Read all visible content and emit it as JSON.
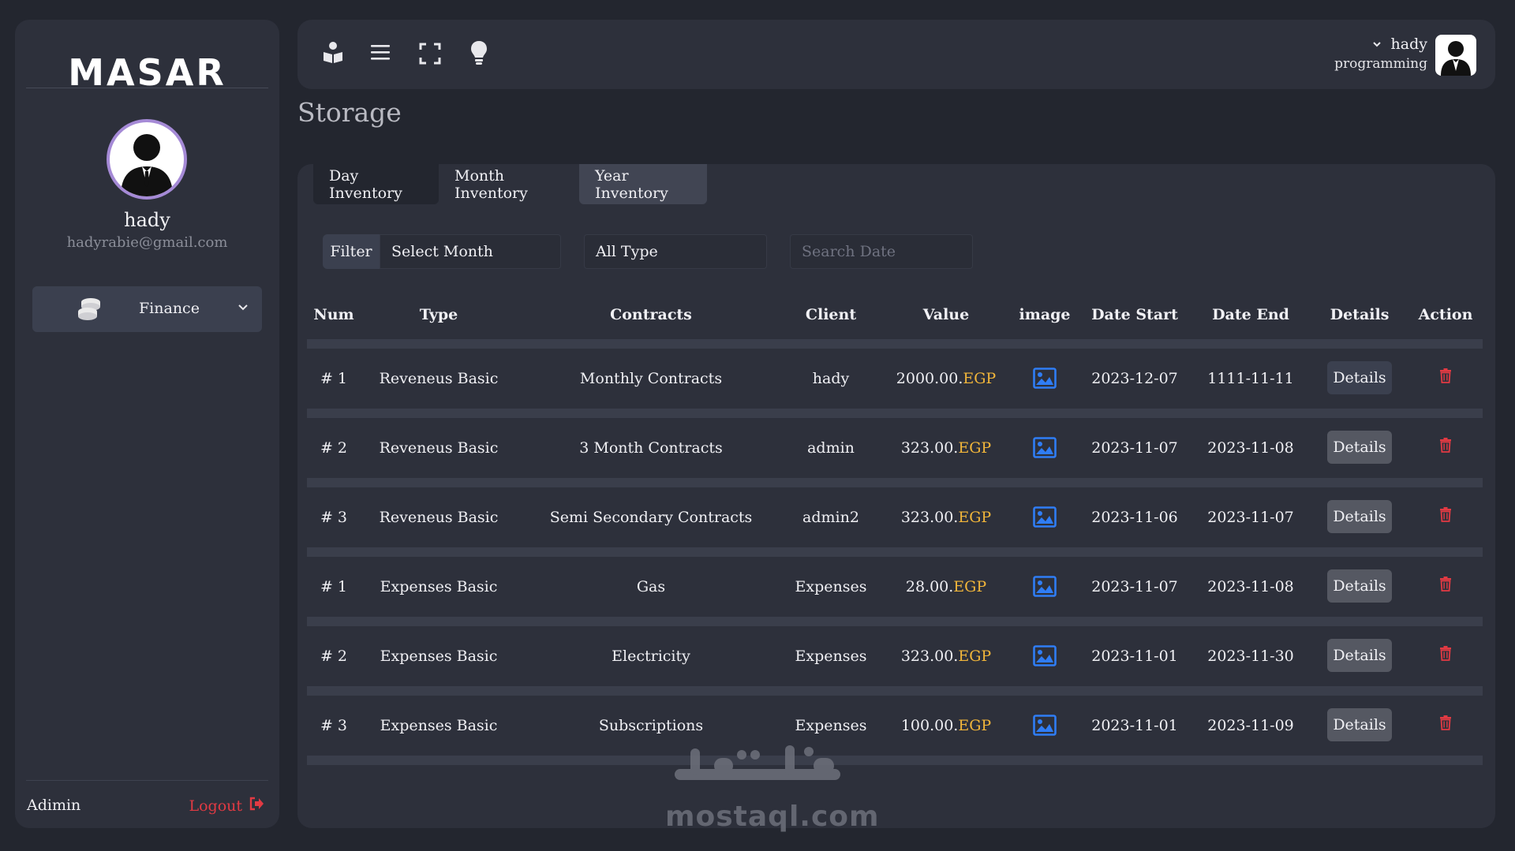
{
  "brand": {
    "logo": "MASAR"
  },
  "sidebar": {
    "user_name": "hady",
    "user_email": "hadyrabie@gmail.com",
    "menu_label": "Finance",
    "footer_role": "Adimin",
    "logout_label": "Logout"
  },
  "topbar": {
    "user_name": "hady",
    "user_role": "programming"
  },
  "page": {
    "title": "Storage"
  },
  "tabs": [
    "Day Inventory",
    "Month Inventory",
    "Year Inventory"
  ],
  "filters": {
    "filter_label": "Filter",
    "month_select": "Select Month",
    "type_select": "All Type",
    "search_placeholder": "Search Date"
  },
  "table": {
    "columns": [
      "Num",
      "Type",
      "Contracts",
      "Client",
      "Value",
      "image",
      "Date Start",
      "Date End",
      "Details",
      "Action"
    ],
    "currency": "EGP",
    "details_label": "Details",
    "rows": [
      {
        "num": "# 1",
        "type": "Reveneus Basic",
        "contract": "Monthly Contracts",
        "client": "hady",
        "value": "2000.00.",
        "date_start": "2023-12-07",
        "date_end": "1111-11-11"
      },
      {
        "num": "# 2",
        "type": "Reveneus Basic",
        "contract": "3 Month Contracts",
        "client": "admin",
        "value": "323.00.",
        "date_start": "2023-11-07",
        "date_end": "2023-11-08"
      },
      {
        "num": "# 3",
        "type": "Reveneus Basic",
        "contract": "Semi Secondary Contracts",
        "client": "admin2",
        "value": "323.00.",
        "date_start": "2023-11-06",
        "date_end": "2023-11-07"
      },
      {
        "num": "# 1",
        "type": "Expenses Basic",
        "contract": "Gas",
        "client": "Expenses",
        "value": "28.00.",
        "date_start": "2023-11-07",
        "date_end": "2023-11-08"
      },
      {
        "num": "# 2",
        "type": "Expenses Basic",
        "contract": "Electricity",
        "client": "Expenses",
        "value": "323.00.",
        "date_start": "2023-11-01",
        "date_end": "2023-11-30"
      },
      {
        "num": "# 3",
        "type": "Expenses Basic",
        "contract": "Subscriptions",
        "client": "Expenses",
        "value": "100.00.",
        "date_start": "2023-11-01",
        "date_end": "2023-11-09"
      }
    ]
  },
  "watermark": {
    "text": "mostaql.com"
  },
  "colors": {
    "accent_currency": "#f2b63a",
    "danger": "#e23a43",
    "image_icon": "#2f7df6"
  }
}
